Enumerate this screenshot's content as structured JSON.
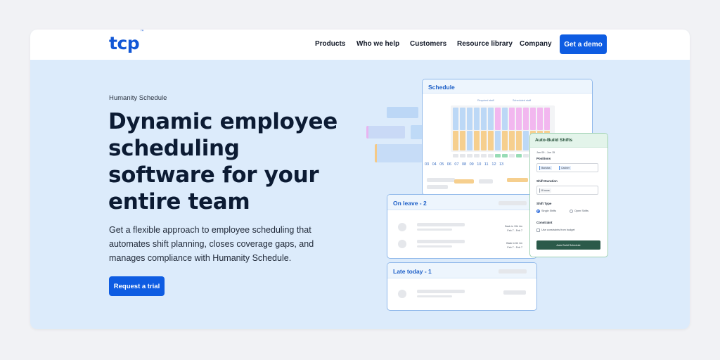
{
  "nav": {
    "logo": "tcp",
    "logo_tm": "™",
    "items": [
      "Products",
      "Who we help",
      "Customers",
      "Resource library",
      "Company"
    ],
    "cta": "Get a demo"
  },
  "hero": {
    "eyebrow": "Humanity Schedule",
    "title": "Dynamic employee scheduling software for your entire team",
    "description": "Get a flexible approach to employee scheduling that automates shift planning, closes coverage gaps, and manages compliance with Humanity Schedule.",
    "cta": "Request a trial"
  },
  "schedule_card": {
    "title": "Schedule",
    "legend": [
      "Required staff",
      "Scheduled staff"
    ],
    "days": [
      "03",
      "04",
      "05",
      "06",
      "07",
      "08",
      "09",
      "10",
      "11",
      "12",
      "13"
    ]
  },
  "leave_card": {
    "title": "On leave - 2",
    "rows": [
      {
        "line1": "Back in 19h 4m",
        "line2": "Feb 7 - Feb 7"
      },
      {
        "line1": "Back in 6h 1m",
        "line2": "Feb 7 - Feb 7"
      }
    ]
  },
  "late_card": {
    "title": "Late today - 1"
  },
  "auto_card": {
    "title": "Auto-Build Shifts",
    "date_range": "Jun 09 - Jun 15",
    "positions_label": "Positions",
    "positions": [
      "Baristas",
      "Cashier"
    ],
    "duration_label": "Shift Duration",
    "duration_value": "8 hours",
    "type_label": "Shift Type",
    "type_options": [
      "Single Shifts",
      "Open Shifts"
    ],
    "constraint_label": "Constraint",
    "constraint_option": "Use constraints from budget",
    "button": "Auto Build Schedule"
  },
  "colors": {
    "brand": "#1257d6",
    "button": "#0e5ce2",
    "hero_bg": "#dcebfb",
    "headline": "#0c1b33"
  }
}
